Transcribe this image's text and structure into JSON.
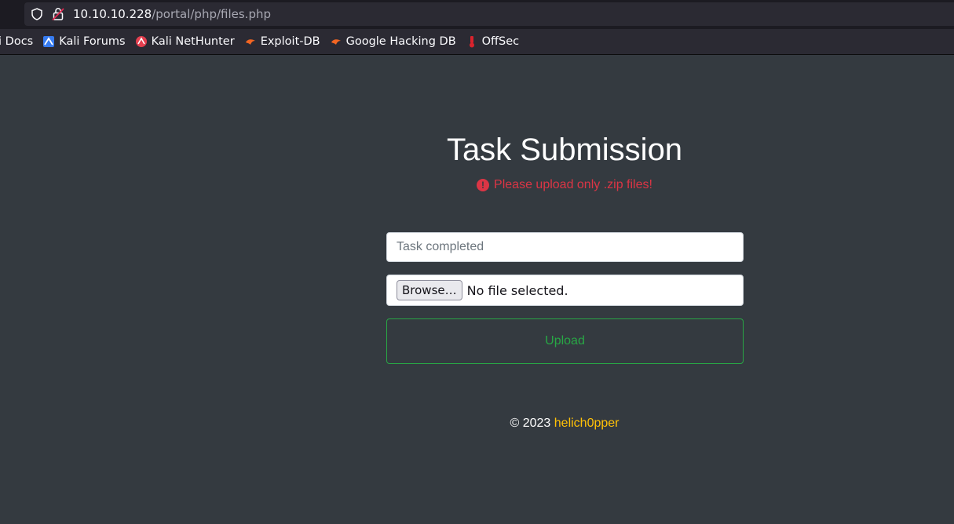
{
  "browser": {
    "url_host": "10.10.10.228",
    "url_path": "/portal/php/files.php",
    "bookmarks": [
      {
        "label": "li Docs",
        "icon": "kali-docs-icon"
      },
      {
        "label": "Kali Forums",
        "icon": "kali-forums-icon"
      },
      {
        "label": "Kali NetHunter",
        "icon": "kali-nethunter-icon"
      },
      {
        "label": "Exploit-DB",
        "icon": "exploit-db-icon"
      },
      {
        "label": "Google Hacking DB",
        "icon": "ghdb-icon"
      },
      {
        "label": "OffSec",
        "icon": "offsec-icon"
      }
    ]
  },
  "page": {
    "title": "Task Submission",
    "alert": "Please upload only .zip files!",
    "task_input": {
      "placeholder": "Task completed",
      "value": ""
    },
    "file": {
      "browse_label": "Browse…",
      "status": "No file selected."
    },
    "upload_label": "Upload",
    "footer": {
      "copyright": "© 2023 ",
      "author": "helich0pper"
    }
  },
  "colors": {
    "background": "#343a40",
    "danger": "#dc3545",
    "success": "#28a745",
    "warning": "#ffc107"
  }
}
